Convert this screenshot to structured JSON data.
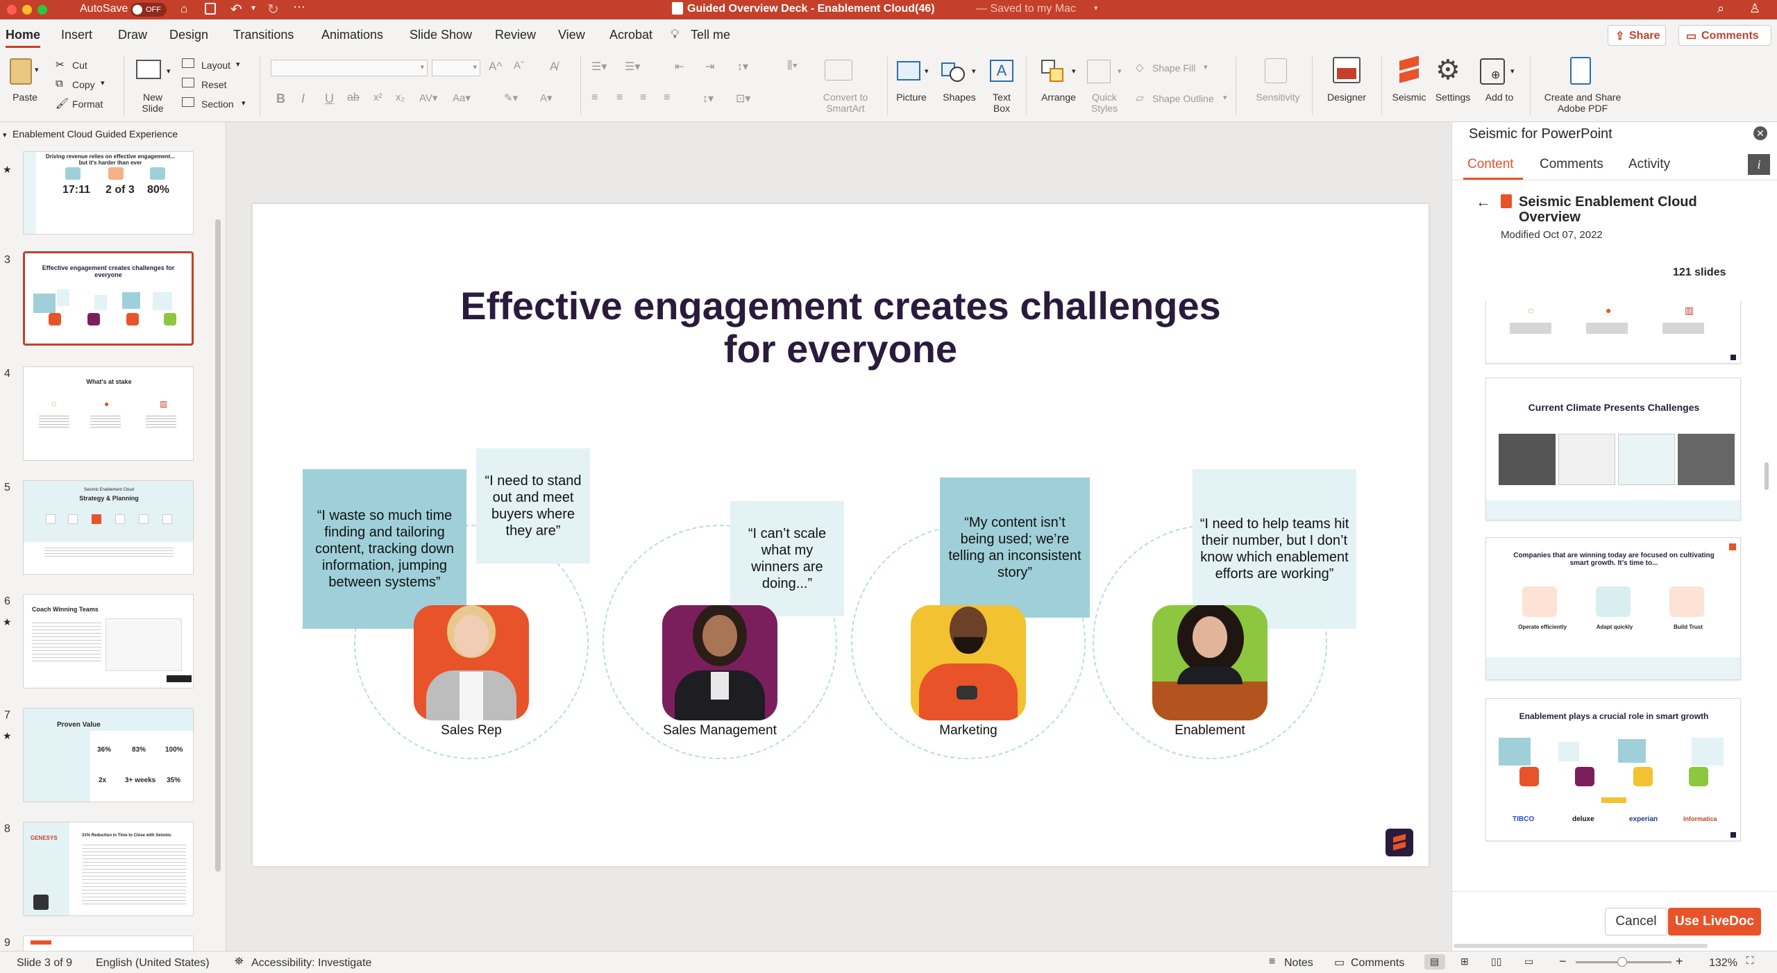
{
  "window": {
    "title": "Guided Overview Deck - Enablement Cloud(46)",
    "save_status": "— Saved to my Mac",
    "autosave_label": "AutoSave",
    "autosave_state": "OFF"
  },
  "ribbon_tabs": [
    "Home",
    "Insert",
    "Draw",
    "Design",
    "Transitions",
    "Animations",
    "Slide Show",
    "Review",
    "View",
    "Acrobat"
  ],
  "tell_me": "Tell me",
  "share_label": "Share",
  "comments_label": "Comments",
  "ribbon": {
    "paste": "Paste",
    "cut": "Cut",
    "copy": "Copy",
    "format": "Format",
    "new_slide": "New Slide",
    "layout": "Layout",
    "reset": "Reset",
    "section": "Section",
    "convert_smartart": "Convert to SmartArt",
    "picture": "Picture",
    "shapes": "Shapes",
    "text_box": "Text Box",
    "arrange": "Arrange",
    "quick_styles": "Quick Styles",
    "shape_fill": "Shape Fill",
    "shape_outline": "Shape Outline",
    "sensitivity": "Sensitivity",
    "designer": "Designer",
    "seismic": "Seismic",
    "settings": "Settings",
    "add_to": "Add to",
    "create_share_pdf": "Create and Share Adobe PDF"
  },
  "section_header": "Enablement Cloud Guided Experience",
  "thumbnails": [
    {
      "num": "",
      "title": "Driving revenue relies on effective engagement... but it's harder than ever",
      "stats": [
        "17:11",
        "2 of 3",
        "80%"
      ]
    },
    {
      "num": "3",
      "title": "Effective engagement creates challenges for everyone"
    },
    {
      "num": "4",
      "title": "What's at stake"
    },
    {
      "num": "5",
      "title": "Strategy & Planning",
      "kicker": "Seismic Enablement Cloud"
    },
    {
      "num": "6",
      "title": "Coach Winning Teams"
    },
    {
      "num": "7",
      "title": "Proven Value",
      "stats": [
        "36%",
        "83%",
        "100%",
        "2x",
        "3+ weeks",
        "35%"
      ]
    },
    {
      "num": "8",
      "title": "31% Reduction in Time to Close with Seismic",
      "brand": "GENESYS"
    },
    {
      "num": "9",
      "title": ""
    }
  ],
  "slide": {
    "title_line1": "Effective engagement creates challenges",
    "title_line2": "for everyone",
    "quotes": [
      "“I waste so much time finding and tailoring content, tracking down information, jumping between systems”",
      "“I need to stand out and meet buyers where they are”",
      "“I can’t scale what my winners are doing...”",
      "“My content isn’t being used; we’re telling an inconsistent story”",
      "“I need to help teams hit their number, but I don’t know which enablement efforts are working”"
    ],
    "personas": [
      "Sales Rep",
      "Sales Management",
      "Marketing",
      "Enablement"
    ]
  },
  "panel": {
    "title": "Seismic for PowerPoint",
    "tabs": [
      "Content",
      "Comments",
      "Activity"
    ],
    "doc_title": "Seismic Enablement Cloud Overview",
    "modified": "Modified Oct 07, 2022",
    "slide_count": "121 slides",
    "thumb_titles": [
      "",
      "Current Climate Presents Challenges",
      "Companies that are winning today are focused on cultivating smart growth. It’s time to...",
      "Enablement plays a crucial role in smart growth"
    ],
    "thumb3_items": [
      "Operate efficiently",
      "Adapt quickly",
      "Build Trust"
    ],
    "thumb4_logos": [
      "TIBCO",
      "deluxe",
      "experian",
      "Informatica"
    ],
    "cancel": "Cancel",
    "use_livedoc": "Use LiveDoc"
  },
  "status": {
    "slide_info": "Slide 3 of 9",
    "language": "English (United States)",
    "accessibility": "Accessibility: Investigate",
    "notes": "Notes",
    "comments": "Comments",
    "zoom": "132%"
  },
  "colors": {
    "titlebar": "#c4402b",
    "accent": "#c4402b",
    "quote_dark": "#9fd0d9",
    "quote_light": "#e3f2f4",
    "seismic_orange": "#e8532a"
  }
}
